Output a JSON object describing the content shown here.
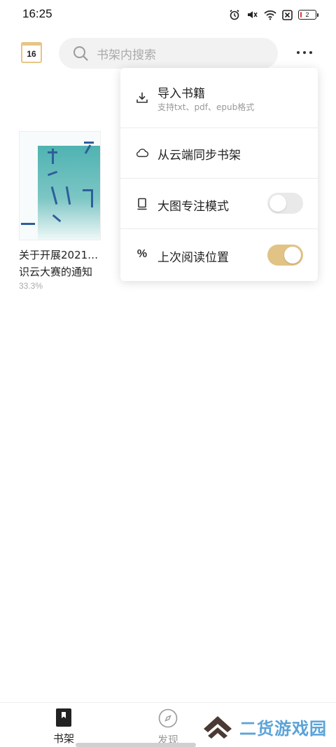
{
  "status_bar": {
    "time": "16:25",
    "battery_level": "2",
    "icons": [
      "alarm-icon",
      "mute-icon",
      "wifi-icon",
      "sim-off-icon",
      "battery-icon"
    ]
  },
  "header": {
    "calendar_day": "16",
    "search_placeholder": "书架内搜索"
  },
  "books": [
    {
      "title": "关于开展2021…识云大赛的通知",
      "progress": "33.3%"
    }
  ],
  "menu": {
    "items": [
      {
        "label": "导入书籍",
        "sublabel": "支持txt、pdf、epub格式",
        "icon": "download-icon"
      },
      {
        "label": "从云端同步书架",
        "icon": "cloud-icon"
      },
      {
        "label": "大图专注模式",
        "icon": "book-icon",
        "toggle": false
      },
      {
        "label": "上次阅读位置",
        "icon": "percent-icon",
        "toggle": true
      }
    ]
  },
  "bottom_nav": {
    "items": [
      {
        "label": "书架",
        "icon": "bookmark-icon",
        "active": true
      },
      {
        "label": "发现",
        "icon": "compass-icon",
        "active": false
      }
    ]
  },
  "watermark": {
    "text": "二货游戏园"
  },
  "colors": {
    "accent": "#e0c385",
    "toggle_off": "#e9e9e9",
    "watermark": "#5aa3d8"
  }
}
